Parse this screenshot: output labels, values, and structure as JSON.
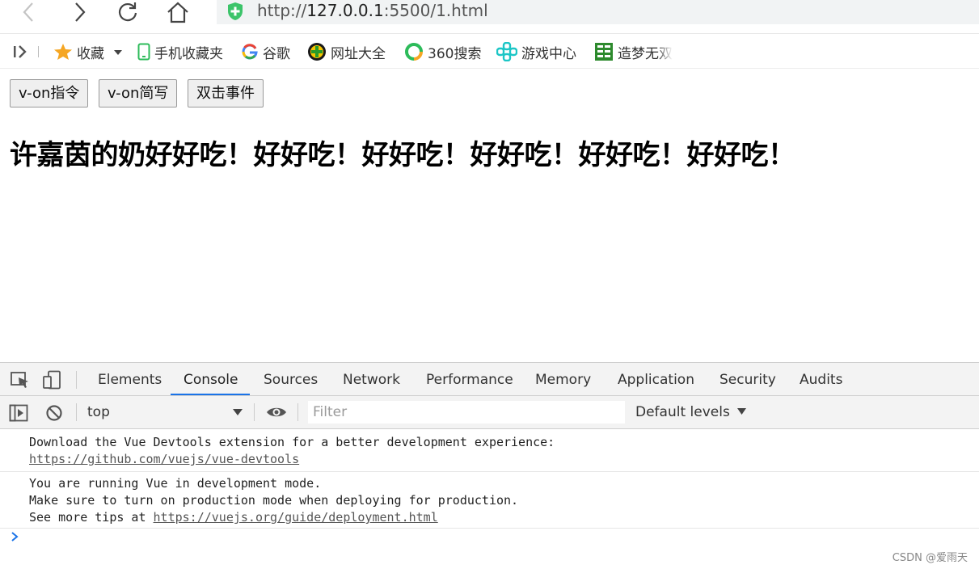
{
  "navbar": {
    "url_scheme": "http://",
    "url_host": "127.0.0.1",
    "url_rest": ":5500/1.html"
  },
  "bookmarks": {
    "items": [
      {
        "label": "收藏",
        "icon": "star-icon"
      },
      {
        "label": "手机收藏夹",
        "icon": "phone-icon"
      },
      {
        "label": "谷歌",
        "icon": "google-icon"
      },
      {
        "label": "网址大全",
        "icon": "web-directory-icon"
      },
      {
        "label": "360搜索",
        "icon": "search-360-icon"
      },
      {
        "label": "游戏中心",
        "icon": "game-center-icon"
      },
      {
        "label": "造梦无双",
        "icon": "game-icon"
      }
    ]
  },
  "page": {
    "buttons": [
      "v-on指令",
      "v-on简写",
      "双击事件"
    ],
    "headline": "许嘉茵的奶好好吃！好好吃！好好吃！好好吃！好好吃！好好吃！"
  },
  "devtools": {
    "tabs": [
      "Elements",
      "Console",
      "Sources",
      "Network",
      "Performance",
      "Memory",
      "Application",
      "Security",
      "Audits"
    ],
    "active_tab": "Console",
    "context": "top",
    "filter_placeholder": "Filter",
    "levels": "Default levels",
    "messages": [
      {
        "text1": "Download the Vue Devtools extension for a better development experience:",
        "link": "https://github.com/vuejs/vue-devtools"
      },
      {
        "text1": "You are running Vue in development mode.",
        "text2": "Make sure to turn on production mode when deploying for production.",
        "text3_prefix": "See more tips at ",
        "link": "https://vuejs.org/guide/deployment.html"
      }
    ]
  },
  "watermark": "CSDN @爱雨天",
  "colors": {
    "accent": "#1a73e8",
    "shield": "#3cc46a"
  }
}
